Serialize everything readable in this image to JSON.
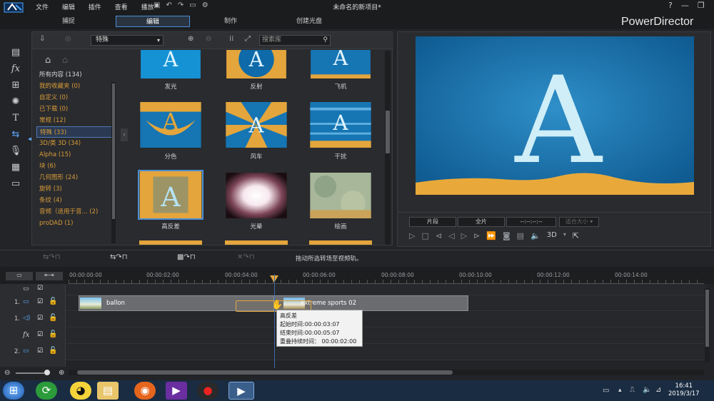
{
  "window": {
    "menus": [
      "文件",
      "编辑",
      "插件",
      "查看",
      "播放"
    ],
    "project_title": "未命名的新项目*",
    "win_buttons": [
      "?",
      "—",
      "❐",
      "✕"
    ]
  },
  "tabs": [
    {
      "label": "捕捉",
      "active": false
    },
    {
      "label": "编辑",
      "active": true
    },
    {
      "label": "制作",
      "active": false
    },
    {
      "label": "创建光盘",
      "active": false
    }
  ],
  "brand": "PowerDirector",
  "library": {
    "dropdown_value": "特殊",
    "search_placeholder": "搜索库",
    "categories": [
      {
        "label": "所有内容 (134)",
        "selected": false
      },
      {
        "label": "我的收藏夹 (0)",
        "selected": false
      },
      {
        "label": "自定义 (0)",
        "selected": false
      },
      {
        "label": "已下载 (0)",
        "selected": false
      },
      {
        "label": "常规 (12)",
        "selected": false
      },
      {
        "label": "特殊 (33)",
        "selected": true
      },
      {
        "label": "3D/类 3D (34)",
        "selected": false
      },
      {
        "label": "Alpha (15)",
        "selected": false
      },
      {
        "label": "块 (6)",
        "selected": false
      },
      {
        "label": "几何图形 (24)",
        "selected": false
      },
      {
        "label": "旋转 (3)",
        "selected": false
      },
      {
        "label": "条纹 (4)",
        "selected": false
      },
      {
        "label": "音频（适用于音... (2)",
        "selected": false
      },
      {
        "label": "proDAD (1)",
        "selected": false
      }
    ],
    "transitions": [
      {
        "label": "发光",
        "selected": false
      },
      {
        "label": "反射",
        "selected": false
      },
      {
        "label": "飞机",
        "selected": false
      },
      {
        "label": "分色",
        "selected": false
      },
      {
        "label": "风车",
        "selected": false
      },
      {
        "label": "干扰",
        "selected": false
      },
      {
        "label": "高反差",
        "selected": true
      },
      {
        "label": "光晕",
        "selected": false
      },
      {
        "label": "绘画",
        "selected": false
      }
    ]
  },
  "preview": {
    "mode_clip": "片段",
    "mode_movie": "全片",
    "timecode": "--:--:--:--",
    "zoom": "适合大小",
    "mode_3d": "3D"
  },
  "timeline": {
    "hint": "拖动所选转场至视频轨。",
    "ruler": [
      "00:00:00:00",
      "00:00:02:00",
      "00:00:04:00",
      "00:00:06:00",
      "00:00:08:00",
      "00:00:10:00",
      "00:00:12:00",
      "00:00:14:00"
    ],
    "tracks": [
      "1.",
      "1.",
      "2."
    ],
    "clips": [
      {
        "label": "ballon"
      },
      {
        "label": "extreme sports 02"
      }
    ],
    "tooltip": {
      "title": "高反差",
      "start": "起始时间:00:00:03:07",
      "end": "结束时间:00:00:05:07",
      "duration": "重叠持续时间： 00:00:02:00"
    }
  },
  "taskbar": {
    "time": "16:41",
    "date": "2019/3/17"
  },
  "colors": {
    "accent": "#4a8ed6",
    "category_text": "#d99c3a",
    "preview_bg": "#1b76b4",
    "sand": "#e8a93a"
  }
}
